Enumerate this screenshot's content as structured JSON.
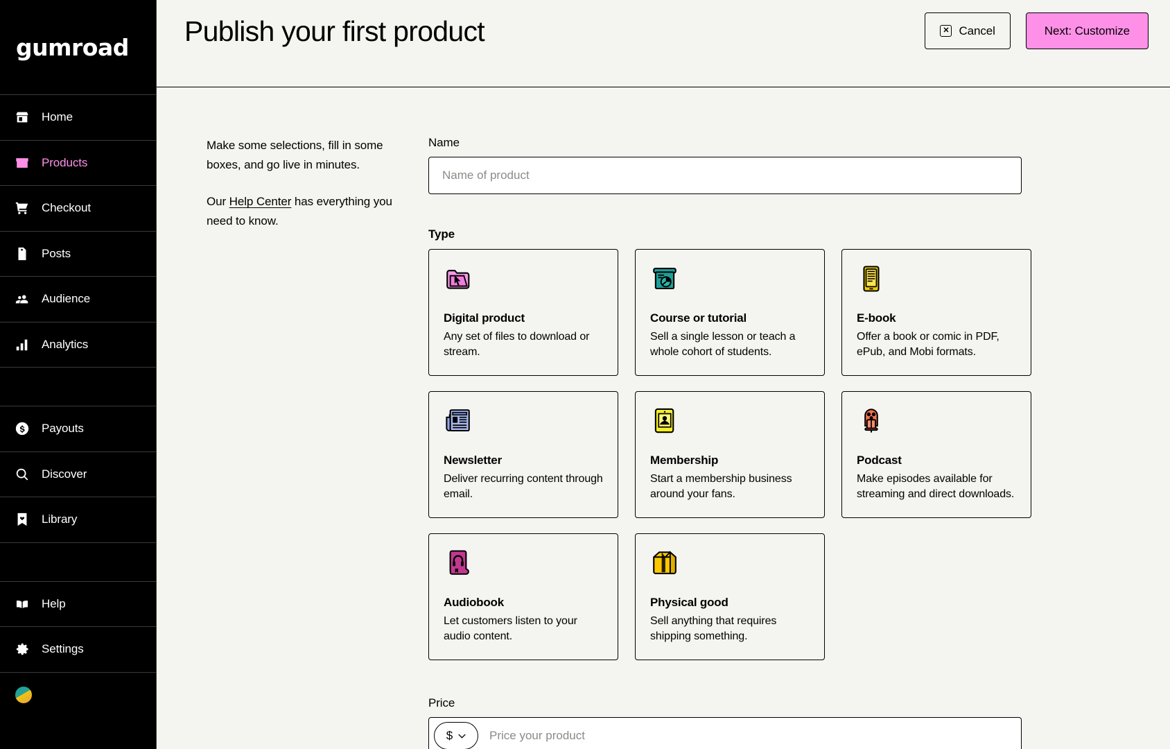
{
  "brand": {
    "logo": "gumroad"
  },
  "sidebar": {
    "items": [
      {
        "label": "Home",
        "icon": "store-icon",
        "active": false
      },
      {
        "label": "Products",
        "icon": "box-icon",
        "active": true
      },
      {
        "label": "Checkout",
        "icon": "shopping-cart-icon",
        "active": false
      },
      {
        "label": "Posts",
        "icon": "document-icon",
        "active": false
      },
      {
        "label": "Audience",
        "icon": "people-icon",
        "active": false
      },
      {
        "label": "Analytics",
        "icon": "bar-chart-icon",
        "active": false
      },
      {
        "label": "Payouts",
        "icon": "dollar-circle-icon",
        "active": false
      },
      {
        "label": "Discover",
        "icon": "search-icon",
        "active": false
      },
      {
        "label": "Library",
        "icon": "bookmark-heart-icon",
        "active": false
      },
      {
        "label": "Help",
        "icon": "open-book-icon",
        "active": false
      },
      {
        "label": "Settings",
        "icon": "gear-icon",
        "active": false
      }
    ]
  },
  "header": {
    "title": "Publish your first product",
    "cancel_label": "Cancel",
    "next_label": "Next: Customize"
  },
  "intro": {
    "paragraph1": "Make some selections, fill in some boxes, and go live in minutes.",
    "p2_before": "Our ",
    "p2_link": "Help Center",
    "p2_after": " has everything you need to know."
  },
  "form": {
    "name_label": "Name",
    "name_value": "",
    "name_placeholder": "Name of product",
    "type_label": "Type",
    "price_label": "Price",
    "price_currency": "$",
    "price_value": "",
    "price_placeholder": "Price your product"
  },
  "product_types": [
    {
      "title": "Digital product",
      "desc": "Any set of files to download or stream.",
      "icon": "folder-cursor-icon",
      "color": "#f79ae8"
    },
    {
      "title": "Course or tutorial",
      "desc": "Sell a single lesson or teach a whole cohort of students.",
      "icon": "presentation-board-icon",
      "color": "#1ca09a"
    },
    {
      "title": "E-book",
      "desc": "Offer a book or comic in PDF, ePub, and Mobi formats.",
      "icon": "ereader-icon",
      "color": "#f2cf00"
    },
    {
      "title": "Newsletter",
      "desc": "Deliver recurring content through email.",
      "icon": "newspaper-icon",
      "color": "#96a8ea"
    },
    {
      "title": "Membership",
      "desc": "Start a membership business around your fans.",
      "icon": "membership-card-icon",
      "color": "#f7ef27"
    },
    {
      "title": "Podcast",
      "desc": "Make episodes available for streaming and direct downloads.",
      "icon": "microphone-icon",
      "color": "#f8734d"
    },
    {
      "title": "Audiobook",
      "desc": "Let customers listen to your audio content.",
      "icon": "audiobook-icon",
      "color": "#c0398f"
    },
    {
      "title": "Physical good",
      "desc": "Sell anything that requires shipping something.",
      "icon": "shipping-box-icon",
      "color": "#fcc800"
    }
  ],
  "colors": {
    "accent_pink": "#ff90e8",
    "background": "#f4f4f0",
    "sidebar_bg": "#000000",
    "border": "#000000"
  }
}
